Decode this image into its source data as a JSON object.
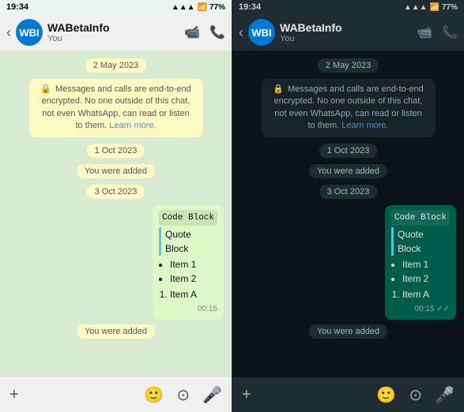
{
  "status": {
    "time": "19:34",
    "battery": "77%",
    "signal": "●●●",
    "wifi": "wifi"
  },
  "header": {
    "name": "WABetaInfo",
    "sub": "You",
    "avatar_initials": "WBI"
  },
  "chat": {
    "date1": "2 May 2023",
    "enc_notice": "Messages and calls are end-to-end encrypted. No one outside of this chat, not even WhatsApp, can read or listen to them.",
    "enc_learn_more": "Learn more.",
    "date2": "1 Oct 2023",
    "added1": "You were added",
    "date3": "3 Oct 2023",
    "code_label": "Code Block",
    "quote_line1": "Quote",
    "quote_line2": "Block",
    "list_item1": "Item 1",
    "list_item2": "Item 2",
    "ordered_item1": "Item A",
    "msg_time": "00:15",
    "added2": "You were added"
  },
  "bottom": {
    "plus": "+",
    "emoji": "☺",
    "camera": "📷",
    "mic": "🎤"
  }
}
